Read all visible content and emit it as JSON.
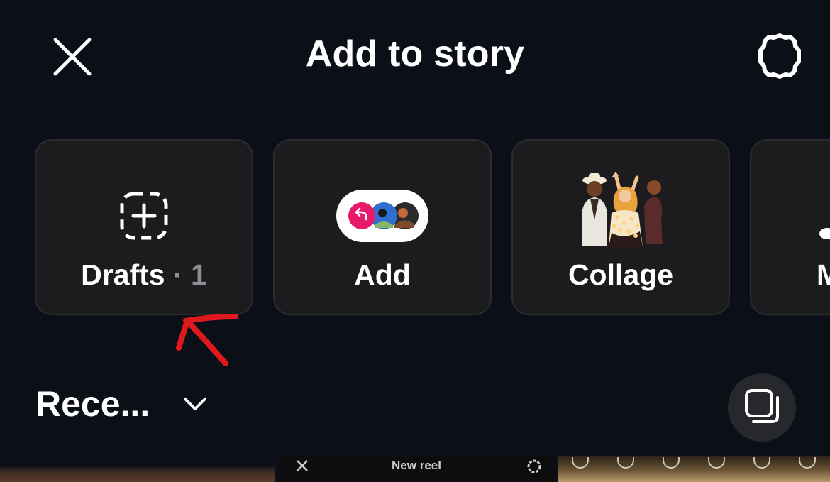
{
  "header": {
    "title": "Add to story",
    "close_icon": "close-icon",
    "settings_icon": "gear-icon"
  },
  "cards": [
    {
      "label": "Drafts",
      "separator": " · ",
      "count": "1",
      "icon": "dashed-plus-icon"
    },
    {
      "label": "Add",
      "icon": "add-yours-sticker-icon"
    },
    {
      "label": "Collage",
      "icon": "collage-people-icon"
    },
    {
      "label": "M",
      "icon": "music-note-icon"
    }
  ],
  "annotation": {
    "color": "#e0191c",
    "icon": "red-arrow-annotation"
  },
  "recents": {
    "label": "Rece...",
    "chevron_icon": "chevron-down-icon",
    "multi_select_icon": "multi-select-icon"
  },
  "gallery": {
    "thumb2_title": "New reel"
  },
  "colors": {
    "background": "#0b0f17",
    "card": "#1c1c1e",
    "accent_pink": "#e8186b",
    "muted_text": "#8e8e93"
  }
}
